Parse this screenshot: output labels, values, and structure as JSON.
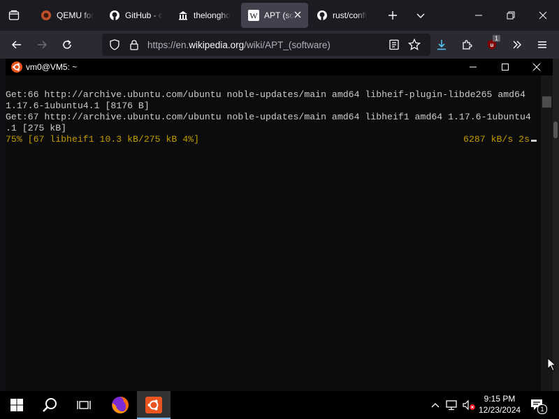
{
  "browser": {
    "tabs": [
      {
        "label": "QEMU for",
        "icon": "qemu-icon"
      },
      {
        "label": "GitHub - c",
        "icon": "github-icon"
      },
      {
        "label": "thelongho",
        "icon": "bank-icon"
      },
      {
        "label": "APT (so",
        "icon": "wikipedia-icon",
        "active": true
      },
      {
        "label": "rust/confi",
        "icon": "github-icon"
      }
    ],
    "url_prefix": "https://en.",
    "url_domain": "wikipedia.org",
    "url_path": "/wiki/APT_(software)",
    "ublock_badge": "1"
  },
  "terminal": {
    "title": "vm0@VM5: ~",
    "lines": [
      "Get:66 http://archive.ubuntu.com/ubuntu noble-updates/main amd64 libheif-plugin-libde265 amd64",
      "1.17.6-1ubuntu4.1 [8176 B]",
      "Get:67 http://archive.ubuntu.com/ubuntu noble-updates/main amd64 libheif1 amd64 1.17.6-1ubuntu4",
      ".1 [275 kB]"
    ],
    "progress_left": "75% [67 libheif1 10.3 kB/275 kB 4%]",
    "progress_right": "6287 kB/s 2s",
    "colors": {
      "background": "#0c0c0c",
      "text": "#cccccc",
      "progress": "#c19c00"
    }
  },
  "taskbar": {
    "time": "9:15 PM",
    "date": "12/23/2024",
    "notification_count": "1"
  }
}
